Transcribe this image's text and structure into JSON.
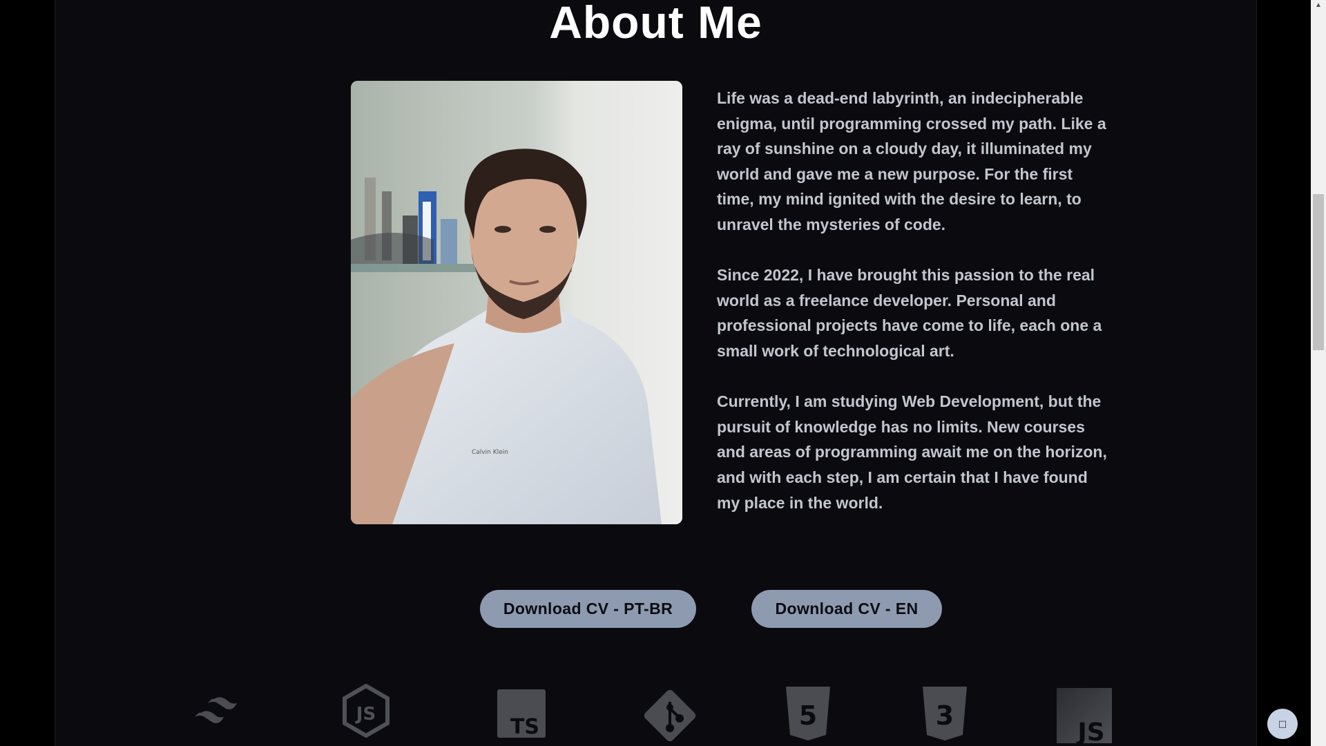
{
  "about": {
    "title": "About Me",
    "photo_alt": "Portrait photo",
    "paragraphs": [
      "Life was a dead-end labyrinth, an indecipherable enigma, until programming crossed my path. Like a ray of sunshine on a cloudy day, it illuminated my world and gave me a new purpose. For the first time, my mind ignited with the desire to learn, to unravel the mysteries of code.",
      "Since 2022, I have brought this passion to the real world as a freelance developer. Personal and professional projects have come to life, each one a small work of technological art.",
      "Currently, I am studying Web Development, but the pursuit of knowledge has no limits. New courses and areas of programming await me on the horizon, and with each step, I am certain that I have found my place in the world."
    ]
  },
  "buttons": {
    "cv_pt": "Download CV - PT-BR",
    "cv_en": "Download CV - EN"
  },
  "tech_icons": [
    {
      "name": "tailwind-icon"
    },
    {
      "name": "nodejs-icon",
      "text": "JS"
    },
    {
      "name": "typescript-icon",
      "text": "TS"
    },
    {
      "name": "git-icon"
    },
    {
      "name": "html5-icon",
      "text": "5"
    },
    {
      "name": "css3-icon",
      "text": "3"
    },
    {
      "name": "javascript-icon",
      "text": "JS"
    }
  ],
  "float_button": {
    "glyph": "□"
  },
  "scrollbar": {
    "up_arrow": "▲"
  },
  "colors": {
    "page_bg": "#0b0b0f",
    "title": "#ffffff",
    "text": "#c2c6cd",
    "button_bg": "#8e9ab0",
    "icon_gray": "#4a4c52"
  }
}
